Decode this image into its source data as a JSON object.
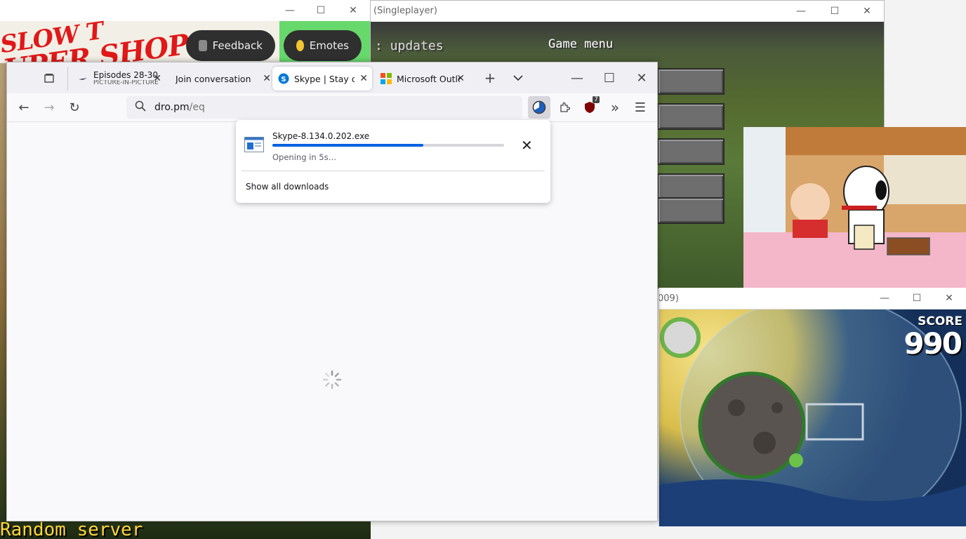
{
  "back_window": {
    "shop_text_1": "SLOW T",
    "shop_text_2": "UPER SHOP",
    "random_server": "Random server"
  },
  "minecraft_window": {
    "title": "(Singleplayer)",
    "feedback_label": "Feedback",
    "emotes_label": "Emotes",
    "updates_text": ": updates",
    "game_menu": "Game menu"
  },
  "angry_birds_window": {
    "title": "009)",
    "score_label": "SCORE",
    "score_value": "990"
  },
  "browser": {
    "tabs": [
      {
        "label": "Episodes 28-30 |",
        "sublabel": "PICTURE-IN-PICTURE"
      },
      {
        "label": "Join conversation"
      },
      {
        "label": "Skype | Stay conn"
      },
      {
        "label": "Microsoft Outlo"
      }
    ],
    "url_host": "dro.pm",
    "url_path": "/eq",
    "extension_badge": "7"
  },
  "downloads_panel": {
    "file_name": "Skype-8.134.0.202.exe",
    "status": "Opening in 5s…",
    "progress": 0.65,
    "show_all": "Show all downloads"
  },
  "colors": {
    "accent": "#0061e0",
    "tab_active_bg": "#ffffff",
    "tabstrip_bg": "#f0f0f4"
  }
}
